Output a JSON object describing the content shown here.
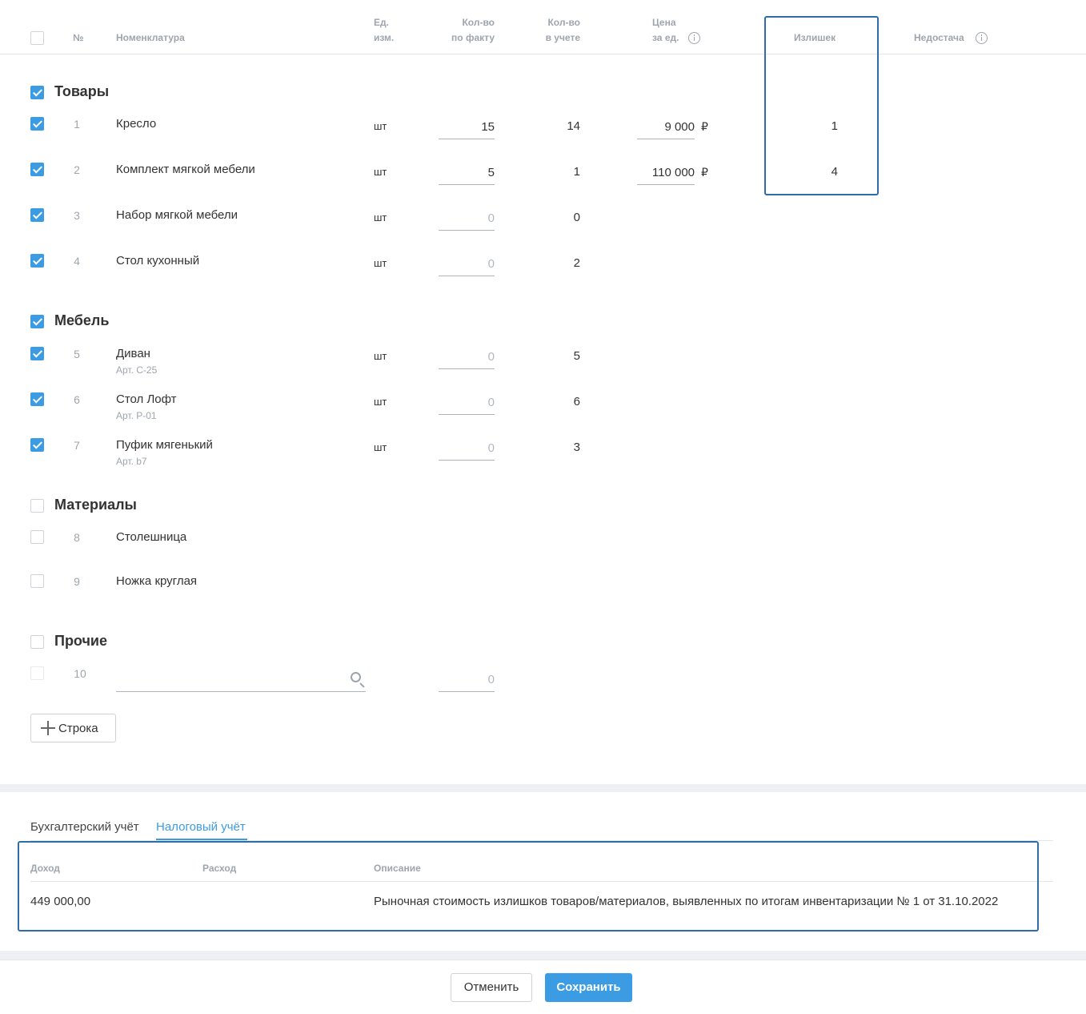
{
  "header": {
    "num": "№",
    "nomenclature": "Номенклатура",
    "unit_line1": "Ед.",
    "unit_line2": "изм.",
    "qty_fact_line1": "Кол-во",
    "qty_fact_line2": "по факту",
    "qty_acc_line1": "Кол-во",
    "qty_acc_line2": "в учете",
    "price_line1": "Цена",
    "price_line2": "за ед.",
    "surplus": "Излишек",
    "shortage": "Недостача"
  },
  "groups": [
    {
      "title": "Товары",
      "checked": true
    },
    {
      "title": "Мебель",
      "checked": true
    },
    {
      "title": "Материалы",
      "checked": false
    },
    {
      "title": "Прочие",
      "checked": false
    }
  ],
  "rows": [
    {
      "num": "1",
      "name": "Кресло",
      "unit": "шт",
      "qty_fact": "15",
      "qty_acc": "14",
      "price": "9 000",
      "currency": "₽",
      "surplus": "1"
    },
    {
      "num": "2",
      "name": "Комплект мягкой мебели",
      "unit": "шт",
      "qty_fact": "5",
      "qty_acc": "1",
      "price": "110 000",
      "currency": "₽",
      "surplus": "4"
    },
    {
      "num": "3",
      "name": "Набор мягкой мебели",
      "unit": "шт",
      "qty_fact": "0",
      "qty_acc": "0"
    },
    {
      "num": "4",
      "name": "Стол кухонный",
      "unit": "шт",
      "qty_fact": "0",
      "qty_acc": "2"
    },
    {
      "num": "5",
      "name": "Диван",
      "article": "Арт. С-25",
      "unit": "шт",
      "qty_fact": "0",
      "qty_acc": "5"
    },
    {
      "num": "6",
      "name": "Стол Лофт",
      "article": "Арт. Р-01",
      "unit": "шт",
      "qty_fact": "0",
      "qty_acc": "6"
    },
    {
      "num": "7",
      "name": "Пуфик мягенький",
      "article": "Арт. b7",
      "unit": "шт",
      "qty_fact": "0",
      "qty_acc": "3"
    },
    {
      "num": "8",
      "name": "Столешница"
    },
    {
      "num": "9",
      "name": "Ножка круглая"
    },
    {
      "num": "10",
      "name": "",
      "qty_fact": "0"
    }
  ],
  "add_row_button": "Строка",
  "tabs": [
    {
      "label": "Бухгалтерский учёт",
      "active": false
    },
    {
      "label": "Налоговый учёт",
      "active": true
    }
  ],
  "tax_table": {
    "headers": {
      "income": "Доход",
      "expense": "Расход",
      "description": "Описание"
    },
    "row": {
      "income": "449 000,00",
      "expense": "",
      "description": "Рыночная стоимость излишков товаров/материалов, выявленных по итогам инвентаризации № 1 от 31.10.2022"
    }
  },
  "footer": {
    "cancel": "Отменить",
    "save": "Сохранить"
  },
  "colors": {
    "accent": "#3c9ce3",
    "highlight_border": "#2f6ca8",
    "muted": "#9ea5ad"
  },
  "icons": [
    "checkbox-icon",
    "info-icon",
    "search-icon",
    "plus-icon"
  ]
}
